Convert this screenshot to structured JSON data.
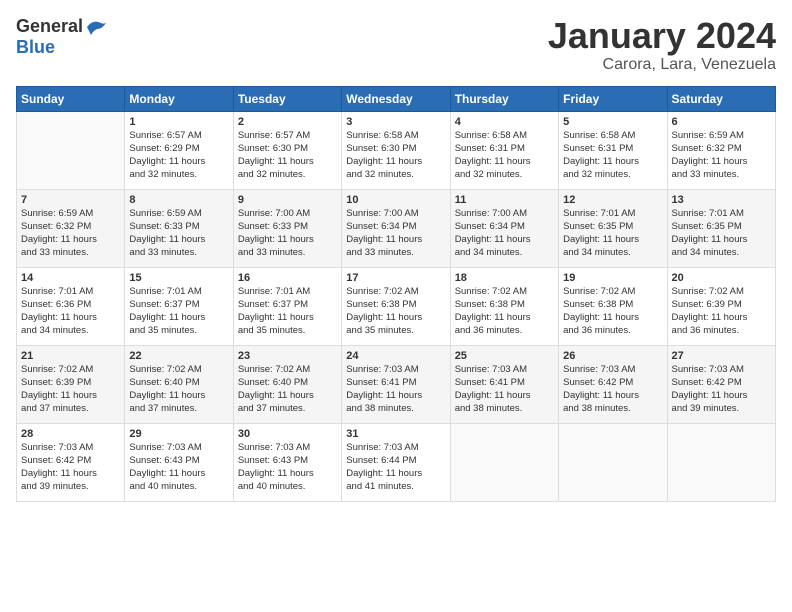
{
  "header": {
    "logo_general": "General",
    "logo_blue": "Blue",
    "month_title": "January 2024",
    "subtitle": "Carora, Lara, Venezuela"
  },
  "days_of_week": [
    "Sunday",
    "Monday",
    "Tuesday",
    "Wednesday",
    "Thursday",
    "Friday",
    "Saturday"
  ],
  "weeks": [
    [
      {
        "day": "",
        "info": ""
      },
      {
        "day": "1",
        "info": "Sunrise: 6:57 AM\nSunset: 6:29 PM\nDaylight: 11 hours\nand 32 minutes."
      },
      {
        "day": "2",
        "info": "Sunrise: 6:57 AM\nSunset: 6:30 PM\nDaylight: 11 hours\nand 32 minutes."
      },
      {
        "day": "3",
        "info": "Sunrise: 6:58 AM\nSunset: 6:30 PM\nDaylight: 11 hours\nand 32 minutes."
      },
      {
        "day": "4",
        "info": "Sunrise: 6:58 AM\nSunset: 6:31 PM\nDaylight: 11 hours\nand 32 minutes."
      },
      {
        "day": "5",
        "info": "Sunrise: 6:58 AM\nSunset: 6:31 PM\nDaylight: 11 hours\nand 32 minutes."
      },
      {
        "day": "6",
        "info": "Sunrise: 6:59 AM\nSunset: 6:32 PM\nDaylight: 11 hours\nand 33 minutes."
      }
    ],
    [
      {
        "day": "7",
        "info": "Sunrise: 6:59 AM\nSunset: 6:32 PM\nDaylight: 11 hours\nand 33 minutes."
      },
      {
        "day": "8",
        "info": "Sunrise: 6:59 AM\nSunset: 6:33 PM\nDaylight: 11 hours\nand 33 minutes."
      },
      {
        "day": "9",
        "info": "Sunrise: 7:00 AM\nSunset: 6:33 PM\nDaylight: 11 hours\nand 33 minutes."
      },
      {
        "day": "10",
        "info": "Sunrise: 7:00 AM\nSunset: 6:34 PM\nDaylight: 11 hours\nand 33 minutes."
      },
      {
        "day": "11",
        "info": "Sunrise: 7:00 AM\nSunset: 6:34 PM\nDaylight: 11 hours\nand 34 minutes."
      },
      {
        "day": "12",
        "info": "Sunrise: 7:01 AM\nSunset: 6:35 PM\nDaylight: 11 hours\nand 34 minutes."
      },
      {
        "day": "13",
        "info": "Sunrise: 7:01 AM\nSunset: 6:35 PM\nDaylight: 11 hours\nand 34 minutes."
      }
    ],
    [
      {
        "day": "14",
        "info": "Sunrise: 7:01 AM\nSunset: 6:36 PM\nDaylight: 11 hours\nand 34 minutes."
      },
      {
        "day": "15",
        "info": "Sunrise: 7:01 AM\nSunset: 6:37 PM\nDaylight: 11 hours\nand 35 minutes."
      },
      {
        "day": "16",
        "info": "Sunrise: 7:01 AM\nSunset: 6:37 PM\nDaylight: 11 hours\nand 35 minutes."
      },
      {
        "day": "17",
        "info": "Sunrise: 7:02 AM\nSunset: 6:38 PM\nDaylight: 11 hours\nand 35 minutes."
      },
      {
        "day": "18",
        "info": "Sunrise: 7:02 AM\nSunset: 6:38 PM\nDaylight: 11 hours\nand 36 minutes."
      },
      {
        "day": "19",
        "info": "Sunrise: 7:02 AM\nSunset: 6:38 PM\nDaylight: 11 hours\nand 36 minutes."
      },
      {
        "day": "20",
        "info": "Sunrise: 7:02 AM\nSunset: 6:39 PM\nDaylight: 11 hours\nand 36 minutes."
      }
    ],
    [
      {
        "day": "21",
        "info": "Sunrise: 7:02 AM\nSunset: 6:39 PM\nDaylight: 11 hours\nand 37 minutes."
      },
      {
        "day": "22",
        "info": "Sunrise: 7:02 AM\nSunset: 6:40 PM\nDaylight: 11 hours\nand 37 minutes."
      },
      {
        "day": "23",
        "info": "Sunrise: 7:02 AM\nSunset: 6:40 PM\nDaylight: 11 hours\nand 37 minutes."
      },
      {
        "day": "24",
        "info": "Sunrise: 7:03 AM\nSunset: 6:41 PM\nDaylight: 11 hours\nand 38 minutes."
      },
      {
        "day": "25",
        "info": "Sunrise: 7:03 AM\nSunset: 6:41 PM\nDaylight: 11 hours\nand 38 minutes."
      },
      {
        "day": "26",
        "info": "Sunrise: 7:03 AM\nSunset: 6:42 PM\nDaylight: 11 hours\nand 38 minutes."
      },
      {
        "day": "27",
        "info": "Sunrise: 7:03 AM\nSunset: 6:42 PM\nDaylight: 11 hours\nand 39 minutes."
      }
    ],
    [
      {
        "day": "28",
        "info": "Sunrise: 7:03 AM\nSunset: 6:42 PM\nDaylight: 11 hours\nand 39 minutes."
      },
      {
        "day": "29",
        "info": "Sunrise: 7:03 AM\nSunset: 6:43 PM\nDaylight: 11 hours\nand 40 minutes."
      },
      {
        "day": "30",
        "info": "Sunrise: 7:03 AM\nSunset: 6:43 PM\nDaylight: 11 hours\nand 40 minutes."
      },
      {
        "day": "31",
        "info": "Sunrise: 7:03 AM\nSunset: 6:44 PM\nDaylight: 11 hours\nand 41 minutes."
      },
      {
        "day": "",
        "info": ""
      },
      {
        "day": "",
        "info": ""
      },
      {
        "day": "",
        "info": ""
      }
    ]
  ]
}
